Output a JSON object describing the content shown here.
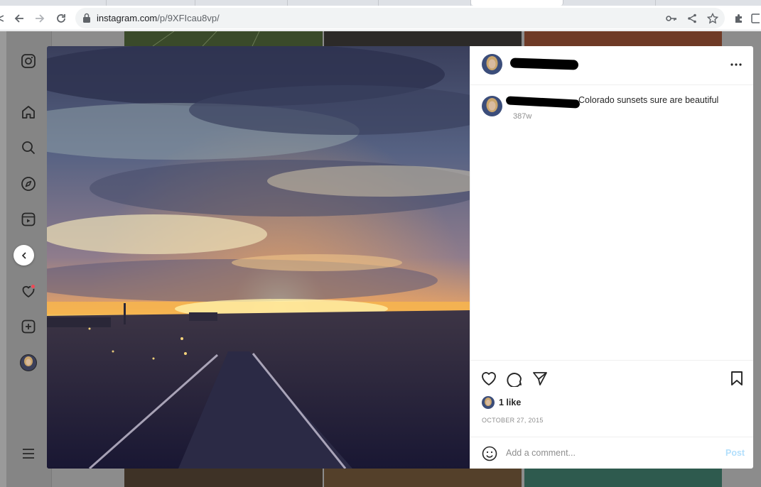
{
  "browser": {
    "url_host": "instagram.com",
    "url_path": "/p/9XFIcau8vp/"
  },
  "post": {
    "caption": "Colorado sunsets sure are beautiful",
    "caption_age": "387w",
    "likes": "1 like",
    "date": "OCTOBER 27, 2015"
  },
  "comment_box": {
    "placeholder": "Add a comment...",
    "post_label": "Post"
  },
  "colors": {
    "link_blue_disabled": "#b2dffc",
    "notification_dot": "#ed4956"
  },
  "icons": {
    "sidebar": [
      "instagram-logo-icon",
      "home-icon",
      "search-icon",
      "explore-icon",
      "reels-icon",
      "heart-icon",
      "create-icon",
      "profile-avatar",
      "menu-icon"
    ],
    "actions": [
      "like-icon",
      "comment-icon",
      "share-icon",
      "save-icon"
    ]
  }
}
